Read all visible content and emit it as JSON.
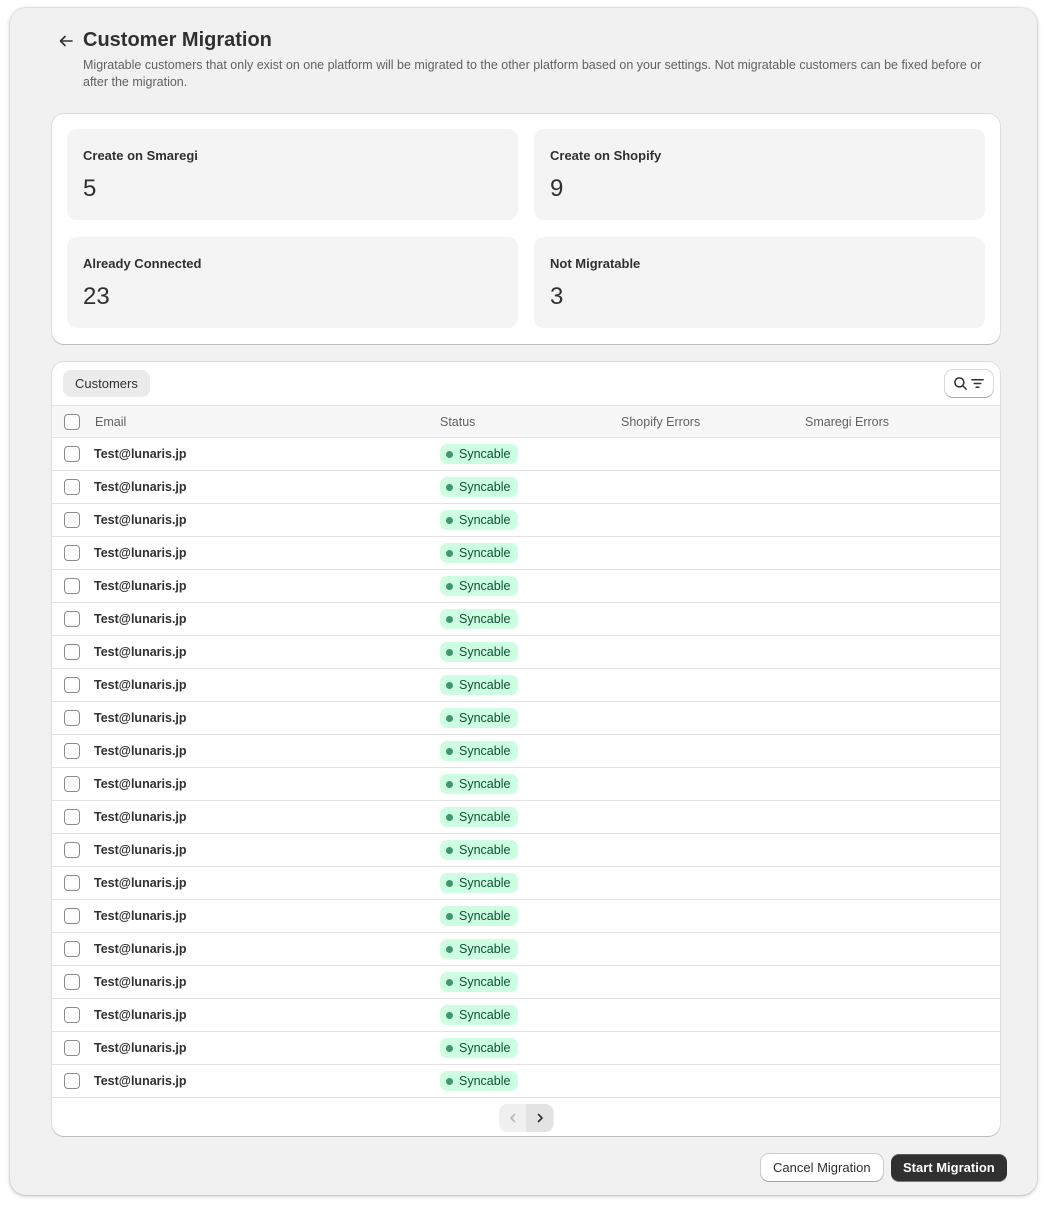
{
  "header": {
    "back_icon": "arrow-left-icon",
    "title": "Customer Migration",
    "description": "Migratable customers that only exist on one platform will be migrated to the other platform based on your settings. Not migratable customers can be fixed before or after the migration."
  },
  "stats": [
    {
      "label": "Create on Smaregi",
      "value": "5"
    },
    {
      "label": "Create on Shopify",
      "value": "9"
    },
    {
      "label": "Already Connected",
      "value": "23"
    },
    {
      "label": "Not Migratable",
      "value": "3"
    }
  ],
  "table": {
    "tab_label": "Customers",
    "search_icon": "search-icon",
    "filter_icon": "filter-icon",
    "columns": [
      "Email",
      "Status",
      "Shopify Errors",
      "Smaregi Errors"
    ],
    "rows": [
      {
        "email": "Test@lunaris.jp",
        "status": "Syncable",
        "shopify_errors": "",
        "smaregi_errors": ""
      },
      {
        "email": "Test@lunaris.jp",
        "status": "Syncable",
        "shopify_errors": "",
        "smaregi_errors": ""
      },
      {
        "email": "Test@lunaris.jp",
        "status": "Syncable",
        "shopify_errors": "",
        "smaregi_errors": ""
      },
      {
        "email": "Test@lunaris.jp",
        "status": "Syncable",
        "shopify_errors": "",
        "smaregi_errors": ""
      },
      {
        "email": "Test@lunaris.jp",
        "status": "Syncable",
        "shopify_errors": "",
        "smaregi_errors": ""
      },
      {
        "email": "Test@lunaris.jp",
        "status": "Syncable",
        "shopify_errors": "",
        "smaregi_errors": ""
      },
      {
        "email": "Test@lunaris.jp",
        "status": "Syncable",
        "shopify_errors": "",
        "smaregi_errors": ""
      },
      {
        "email": "Test@lunaris.jp",
        "status": "Syncable",
        "shopify_errors": "",
        "smaregi_errors": ""
      },
      {
        "email": "Test@lunaris.jp",
        "status": "Syncable",
        "shopify_errors": "",
        "smaregi_errors": ""
      },
      {
        "email": "Test@lunaris.jp",
        "status": "Syncable",
        "shopify_errors": "",
        "smaregi_errors": ""
      },
      {
        "email": "Test@lunaris.jp",
        "status": "Syncable",
        "shopify_errors": "",
        "smaregi_errors": ""
      },
      {
        "email": "Test@lunaris.jp",
        "status": "Syncable",
        "shopify_errors": "",
        "smaregi_errors": ""
      },
      {
        "email": "Test@lunaris.jp",
        "status": "Syncable",
        "shopify_errors": "",
        "smaregi_errors": ""
      },
      {
        "email": "Test@lunaris.jp",
        "status": "Syncable",
        "shopify_errors": "",
        "smaregi_errors": ""
      },
      {
        "email": "Test@lunaris.jp",
        "status": "Syncable",
        "shopify_errors": "",
        "smaregi_errors": ""
      },
      {
        "email": "Test@lunaris.jp",
        "status": "Syncable",
        "shopify_errors": "",
        "smaregi_errors": ""
      },
      {
        "email": "Test@lunaris.jp",
        "status": "Syncable",
        "shopify_errors": "",
        "smaregi_errors": ""
      },
      {
        "email": "Test@lunaris.jp",
        "status": "Syncable",
        "shopify_errors": "",
        "smaregi_errors": ""
      },
      {
        "email": "Test@lunaris.jp",
        "status": "Syncable",
        "shopify_errors": "",
        "smaregi_errors": ""
      },
      {
        "email": "Test@lunaris.jp",
        "status": "Syncable",
        "shopify_errors": "",
        "smaregi_errors": ""
      }
    ],
    "pagination": {
      "prev_icon": "chevron-left-icon",
      "next_icon": "chevron-right-icon",
      "prev_enabled": false,
      "next_enabled": true
    }
  },
  "footer": {
    "cancel_label": "Cancel Migration",
    "start_label": "Start Migration"
  },
  "colors": {
    "badge_bg": "#cdfee1",
    "badge_text": "#0c5132",
    "badge_dot": "#29845a",
    "primary_button": "#303030"
  }
}
